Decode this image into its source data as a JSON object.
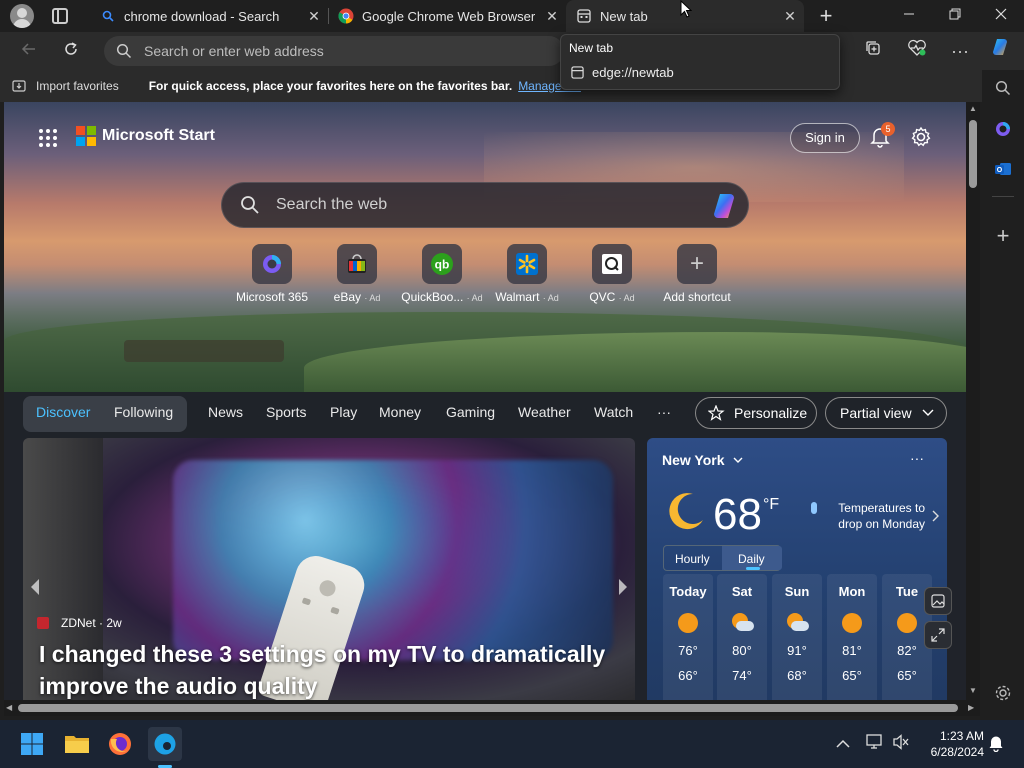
{
  "tabs": [
    {
      "title": "chrome download - Search",
      "icon": "search-icon"
    },
    {
      "title": "Google Chrome Web Browser",
      "icon": "chrome-icon"
    },
    {
      "title": "New tab",
      "icon": "newtab-icon",
      "active": true
    }
  ],
  "tab_popup": {
    "title": "New tab",
    "url": "edge://newtab"
  },
  "address": {
    "placeholder": "Search or enter web address"
  },
  "favbar": {
    "import_label": "Import favorites",
    "hint": "For quick access, place your favorites here on the favorites bar.",
    "link": "Manage fav"
  },
  "brand": {
    "name": "Microsoft Start"
  },
  "header": {
    "signin": "Sign in",
    "notif_count": "5"
  },
  "search": {
    "placeholder": "Search the web"
  },
  "shortcuts": [
    {
      "label": "Microsoft 365",
      "ad": "",
      "icon": "m365-icon"
    },
    {
      "label": "eBay",
      "ad": "· Ad",
      "icon": "ebay-icon"
    },
    {
      "label": "QuickBoo...",
      "ad": "· Ad",
      "icon": "quickbooks-icon"
    },
    {
      "label": "Walmart",
      "ad": "· Ad",
      "icon": "walmart-icon"
    },
    {
      "label": "QVC",
      "ad": "· Ad",
      "icon": "qvc-icon"
    },
    {
      "label": "Add shortcut",
      "ad": "",
      "icon": "plus-icon"
    }
  ],
  "nav": {
    "discover": "Discover",
    "following": "Following",
    "items": [
      "News",
      "Sports",
      "Play",
      "Money",
      "Gaming",
      "Weather",
      "Watch",
      "···"
    ],
    "personalize": "Personalize",
    "partial_view": "Partial view"
  },
  "story": {
    "source": "ZDNet · 2w",
    "headline": "I changed these 3 settings on my TV to dramatically improve the audio quality"
  },
  "weather": {
    "city": "New York",
    "temp": "68",
    "unit": "°F",
    "alert": "Temperatures to drop on Monday",
    "tab_hourly": "Hourly",
    "tab_daily": "Daily",
    "days": [
      {
        "name": "Today",
        "hi": "76°",
        "lo": "66°",
        "icon": "sun"
      },
      {
        "name": "Sat",
        "hi": "80°",
        "lo": "74°",
        "icon": "partly-cloudy"
      },
      {
        "name": "Sun",
        "hi": "91°",
        "lo": "68°",
        "icon": "partly-cloudy"
      },
      {
        "name": "Mon",
        "hi": "81°",
        "lo": "65°",
        "icon": "sun"
      },
      {
        "name": "Tue",
        "hi": "82°",
        "lo": "65°",
        "icon": "sun"
      }
    ]
  },
  "taskbar": {
    "time": "1:23 AM",
    "date": "6/28/2024"
  },
  "colors": {
    "accent": "#4cc2ff",
    "brand_blue": "#0078d4",
    "sun": "#f59a1a"
  }
}
